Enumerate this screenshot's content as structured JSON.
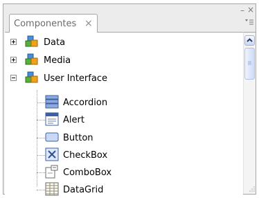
{
  "panel": {
    "tab_label": "Componentes",
    "tab_close": "×",
    "minimize": "–",
    "close": "×"
  },
  "tree": [
    {
      "label": "Data",
      "type": "category",
      "expanded": false,
      "icon": "cubes-icon"
    },
    {
      "label": "Media",
      "type": "category",
      "expanded": false,
      "icon": "cubes-icon"
    },
    {
      "label": "User Interface",
      "type": "category",
      "expanded": true,
      "icon": "cubes-icon",
      "children": [
        {
          "label": "Accordion",
          "icon": "accordion-icon"
        },
        {
          "label": "Alert",
          "icon": "alert-icon"
        },
        {
          "label": "Button",
          "icon": "button-icon"
        },
        {
          "label": "CheckBox",
          "icon": "checkbox-icon"
        },
        {
          "label": "ComboBox",
          "icon": "combobox-icon"
        },
        {
          "label": "DataGrid",
          "icon": "datagrid-icon"
        }
      ]
    }
  ],
  "colors": {
    "border": "#a6a6a6",
    "scroll_accent": "#c9d7f3",
    "icon_blue": "#3a5fa8"
  }
}
